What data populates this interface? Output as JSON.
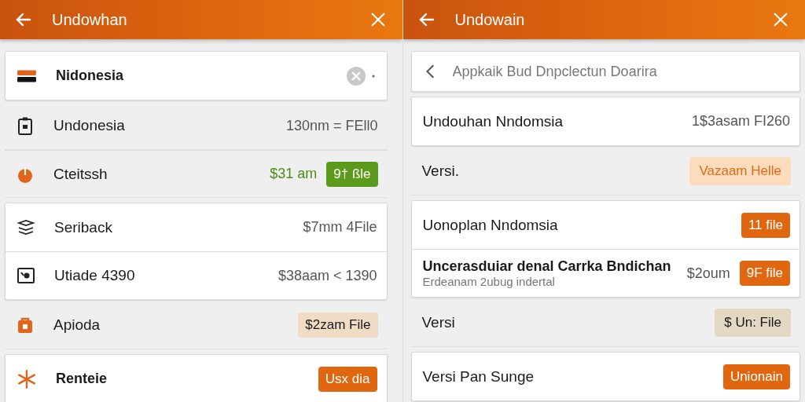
{
  "panels": [
    {
      "header": {
        "title": "Undowhan"
      },
      "groups": [
        {
          "card": true,
          "rows": [
            {
              "kind": "clearable",
              "label": "Nidonesia",
              "bold": true
            }
          ]
        },
        {
          "card": false,
          "rows": [
            {
              "kind": "item",
              "label": "Undonesia",
              "bold": false,
              "value": "130nm = FEll0"
            },
            {
              "kind": "item",
              "label": "Cteitssh",
              "bold": false,
              "value": "$31 am",
              "badge": {
                "text": "9† ßle",
                "kind": "green"
              }
            }
          ]
        },
        {
          "card": true,
          "rows": [
            {
              "kind": "item",
              "label": "Seriback",
              "bold": false,
              "value": "$7mm 4File"
            },
            {
              "kind": "item",
              "label": "Utiade 4390",
              "bold": false,
              "value": "$38aam < 1390"
            }
          ]
        },
        {
          "card": false,
          "rows": [
            {
              "kind": "item",
              "label": "Apioda",
              "bold": false,
              "badge": {
                "text": "$2zam File",
                "kind": "tan"
              }
            }
          ]
        },
        {
          "card": true,
          "rows": [
            {
              "kind": "item",
              "label": "Renteie",
              "bold": true,
              "badge": {
                "text": "Usx dia",
                "kind": "orange"
              }
            }
          ]
        }
      ]
    },
    {
      "header": {
        "title": "Undowain"
      },
      "groups": [
        {
          "card": true,
          "rows": [
            {
              "kind": "search",
              "placeholder": "Appkaik Bud Dnpclectun Doarira"
            }
          ]
        },
        {
          "card": true,
          "rows": [
            {
              "kind": "item",
              "label": "Undouhan Nndomsia",
              "bold": false,
              "value": "1$3asam FI260"
            }
          ]
        },
        {
          "card": false,
          "rows": [
            {
              "kind": "item",
              "label": "Versi.",
              "bold": false,
              "badge": {
                "text": "Vazaam Helle",
                "kind": "peach"
              }
            }
          ]
        },
        {
          "card": true,
          "rows": [
            {
              "kind": "item",
              "label": "Uonoplan Nndomsia",
              "bold": false,
              "badge": {
                "text": "11 file",
                "kind": "orange"
              }
            },
            {
              "kind": "item",
              "label": "Uncerasduiar denal Carrka Bndichan",
              "sub": "Erdeanam 2ubug indertal",
              "bold": true,
              "value": "$2oum",
              "badge": {
                "text": "9F file",
                "kind": "orange"
              }
            }
          ]
        },
        {
          "card": false,
          "rows": [
            {
              "kind": "item",
              "label": "Versi",
              "bold": false,
              "badge": {
                "text": "$ Un: File",
                "kind": "khaki"
              }
            }
          ]
        },
        {
          "card": true,
          "rows": [
            {
              "kind": "item",
              "label": "Versi Pan Sunge",
              "bold": false,
              "badge": {
                "text": "Unionain",
                "kind": "orange"
              }
            }
          ]
        }
      ]
    }
  ]
}
